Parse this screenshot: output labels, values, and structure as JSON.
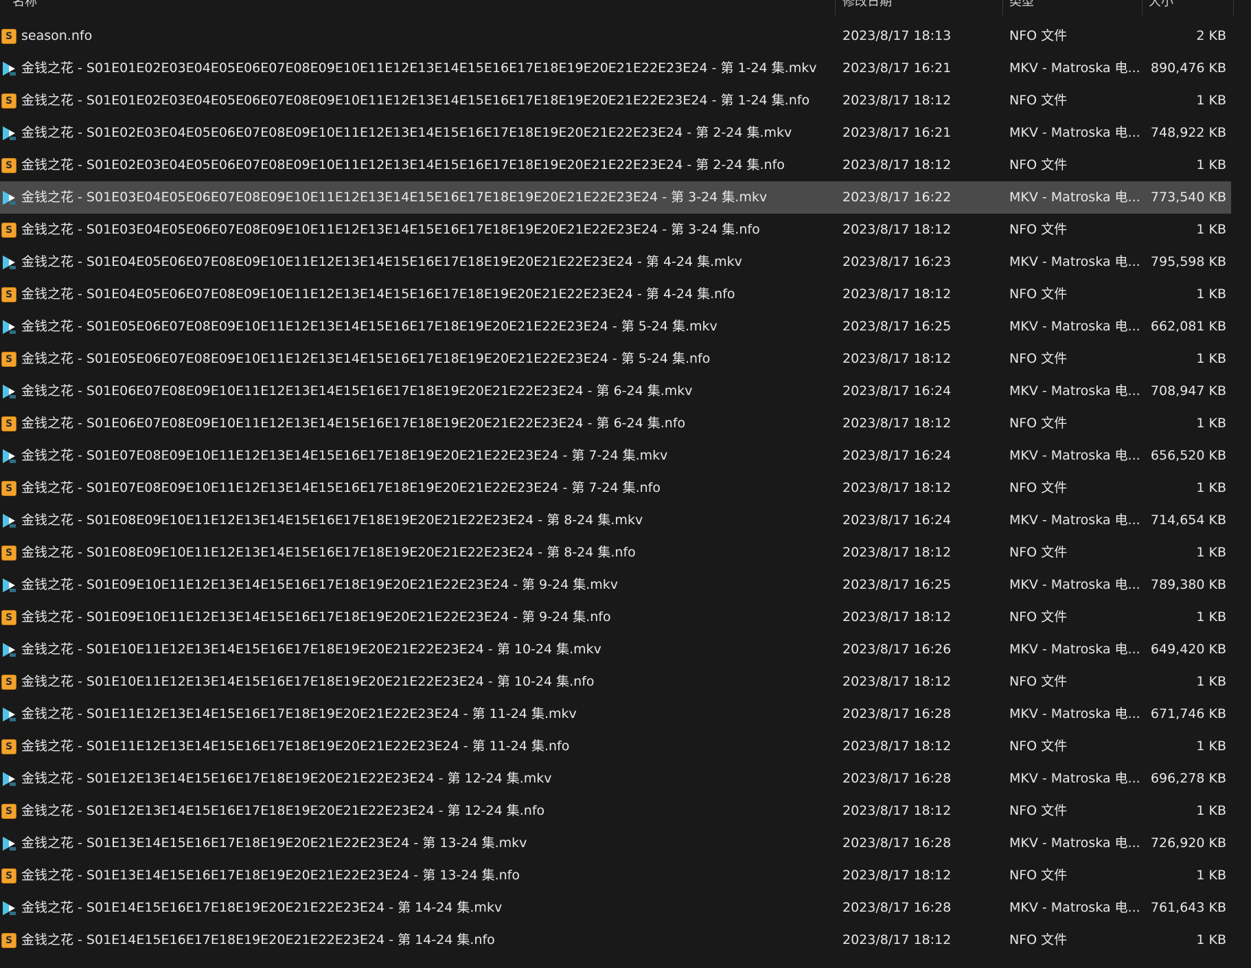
{
  "columns": {
    "name": "名称",
    "date": "修改日期",
    "type": "类型",
    "size": "大小"
  },
  "colors": {
    "background": "#191919",
    "selected_row": "#4a4a4a",
    "nfo_icon": "#f3a32b",
    "mkv_icon": "#4fc3e8"
  },
  "files": [
    {
      "name": "season.nfo",
      "date": "2023/8/17 18:13",
      "type": "NFO 文件",
      "size": "2 KB",
      "icon": "nfo-file-icon"
    },
    {
      "name": "金钱之花 - S01E01E02E03E04E05E06E07E08E09E10E11E12E13E14E15E16E17E18E19E20E21E22E23E24 - 第 1-24 集.mkv",
      "date": "2023/8/17 16:21",
      "type": "MKV - Matroska 电...",
      "size": "890,476 KB",
      "icon": "mkv-file-icon"
    },
    {
      "name": "金钱之花 - S01E01E02E03E04E05E06E07E08E09E10E11E12E13E14E15E16E17E18E19E20E21E22E23E24 - 第 1-24 集.nfo",
      "date": "2023/8/17 18:12",
      "type": "NFO 文件",
      "size": "1 KB",
      "icon": "nfo-file-icon"
    },
    {
      "name": "金钱之花 - S01E02E03E04E05E06E07E08E09E10E11E12E13E14E15E16E17E18E19E20E21E22E23E24 - 第 2-24 集.mkv",
      "date": "2023/8/17 16:21",
      "type": "MKV - Matroska 电...",
      "size": "748,922 KB",
      "icon": "mkv-file-icon"
    },
    {
      "name": "金钱之花 - S01E02E03E04E05E06E07E08E09E10E11E12E13E14E15E16E17E18E19E20E21E22E23E24 - 第 2-24 集.nfo",
      "date": "2023/8/17 18:12",
      "type": "NFO 文件",
      "size": "1 KB",
      "icon": "nfo-file-icon"
    },
    {
      "name": "金钱之花 - S01E03E04E05E06E07E08E09E10E11E12E13E14E15E16E17E18E19E20E21E22E23E24 - 第 3-24 集.mkv",
      "date": "2023/8/17 16:22",
      "type": "MKV - Matroska 电...",
      "size": "773,540 KB",
      "icon": "mkv-file-icon",
      "selected": true
    },
    {
      "name": "金钱之花 - S01E03E04E05E06E07E08E09E10E11E12E13E14E15E16E17E18E19E20E21E22E23E24 - 第 3-24 集.nfo",
      "date": "2023/8/17 18:12",
      "type": "NFO 文件",
      "size": "1 KB",
      "icon": "nfo-file-icon"
    },
    {
      "name": "金钱之花 - S01E04E05E06E07E08E09E10E11E12E13E14E15E16E17E18E19E20E21E22E23E24 - 第 4-24 集.mkv",
      "date": "2023/8/17 16:23",
      "type": "MKV - Matroska 电...",
      "size": "795,598 KB",
      "icon": "mkv-file-icon"
    },
    {
      "name": "金钱之花 - S01E04E05E06E07E08E09E10E11E12E13E14E15E16E17E18E19E20E21E22E23E24 - 第 4-24 集.nfo",
      "date": "2023/8/17 18:12",
      "type": "NFO 文件",
      "size": "1 KB",
      "icon": "nfo-file-icon"
    },
    {
      "name": "金钱之花 - S01E05E06E07E08E09E10E11E12E13E14E15E16E17E18E19E20E21E22E23E24 - 第 5-24 集.mkv",
      "date": "2023/8/17 16:25",
      "type": "MKV - Matroska 电...",
      "size": "662,081 KB",
      "icon": "mkv-file-icon"
    },
    {
      "name": "金钱之花 - S01E05E06E07E08E09E10E11E12E13E14E15E16E17E18E19E20E21E22E23E24 - 第 5-24 集.nfo",
      "date": "2023/8/17 18:12",
      "type": "NFO 文件",
      "size": "1 KB",
      "icon": "nfo-file-icon"
    },
    {
      "name": "金钱之花 - S01E06E07E08E09E10E11E12E13E14E15E16E17E18E19E20E21E22E23E24 - 第 6-24 集.mkv",
      "date": "2023/8/17 16:24",
      "type": "MKV - Matroska 电...",
      "size": "708,947 KB",
      "icon": "mkv-file-icon"
    },
    {
      "name": "金钱之花 - S01E06E07E08E09E10E11E12E13E14E15E16E17E18E19E20E21E22E23E24 - 第 6-24 集.nfo",
      "date": "2023/8/17 18:12",
      "type": "NFO 文件",
      "size": "1 KB",
      "icon": "nfo-file-icon"
    },
    {
      "name": "金钱之花 - S01E07E08E09E10E11E12E13E14E15E16E17E18E19E20E21E22E23E24 - 第 7-24 集.mkv",
      "date": "2023/8/17 16:24",
      "type": "MKV - Matroska 电...",
      "size": "656,520 KB",
      "icon": "mkv-file-icon"
    },
    {
      "name": "金钱之花 - S01E07E08E09E10E11E12E13E14E15E16E17E18E19E20E21E22E23E24 - 第 7-24 集.nfo",
      "date": "2023/8/17 18:12",
      "type": "NFO 文件",
      "size": "1 KB",
      "icon": "nfo-file-icon"
    },
    {
      "name": "金钱之花 - S01E08E09E10E11E12E13E14E15E16E17E18E19E20E21E22E23E24 - 第 8-24 集.mkv",
      "date": "2023/8/17 16:24",
      "type": "MKV - Matroska 电...",
      "size": "714,654 KB",
      "icon": "mkv-file-icon"
    },
    {
      "name": "金钱之花 - S01E08E09E10E11E12E13E14E15E16E17E18E19E20E21E22E23E24 - 第 8-24 集.nfo",
      "date": "2023/8/17 18:12",
      "type": "NFO 文件",
      "size": "1 KB",
      "icon": "nfo-file-icon"
    },
    {
      "name": "金钱之花 - S01E09E10E11E12E13E14E15E16E17E18E19E20E21E22E23E24 - 第 9-24 集.mkv",
      "date": "2023/8/17 16:25",
      "type": "MKV - Matroska 电...",
      "size": "789,380 KB",
      "icon": "mkv-file-icon"
    },
    {
      "name": "金钱之花 - S01E09E10E11E12E13E14E15E16E17E18E19E20E21E22E23E24 - 第 9-24 集.nfo",
      "date": "2023/8/17 18:12",
      "type": "NFO 文件",
      "size": "1 KB",
      "icon": "nfo-file-icon"
    },
    {
      "name": "金钱之花 - S01E10E11E12E13E14E15E16E17E18E19E20E21E22E23E24 - 第 10-24 集.mkv",
      "date": "2023/8/17 16:26",
      "type": "MKV - Matroska 电...",
      "size": "649,420 KB",
      "icon": "mkv-file-icon"
    },
    {
      "name": "金钱之花 - S01E10E11E12E13E14E15E16E17E18E19E20E21E22E23E24 - 第 10-24 集.nfo",
      "date": "2023/8/17 18:12",
      "type": "NFO 文件",
      "size": "1 KB",
      "icon": "nfo-file-icon"
    },
    {
      "name": "金钱之花 - S01E11E12E13E14E15E16E17E18E19E20E21E22E23E24 - 第 11-24 集.mkv",
      "date": "2023/8/17 16:28",
      "type": "MKV - Matroska 电...",
      "size": "671,746 KB",
      "icon": "mkv-file-icon"
    },
    {
      "name": "金钱之花 - S01E11E12E13E14E15E16E17E18E19E20E21E22E23E24 - 第 11-24 集.nfo",
      "date": "2023/8/17 18:12",
      "type": "NFO 文件",
      "size": "1 KB",
      "icon": "nfo-file-icon"
    },
    {
      "name": "金钱之花 - S01E12E13E14E15E16E17E18E19E20E21E22E23E24 - 第 12-24 集.mkv",
      "date": "2023/8/17 16:28",
      "type": "MKV - Matroska 电...",
      "size": "696,278 KB",
      "icon": "mkv-file-icon"
    },
    {
      "name": "金钱之花 - S01E12E13E14E15E16E17E18E19E20E21E22E23E24 - 第 12-24 集.nfo",
      "date": "2023/8/17 18:12",
      "type": "NFO 文件",
      "size": "1 KB",
      "icon": "nfo-file-icon"
    },
    {
      "name": "金钱之花 - S01E13E14E15E16E17E18E19E20E21E22E23E24 - 第 13-24 集.mkv",
      "date": "2023/8/17 16:28",
      "type": "MKV - Matroska 电...",
      "size": "726,920 KB",
      "icon": "mkv-file-icon"
    },
    {
      "name": "金钱之花 - S01E13E14E15E16E17E18E19E20E21E22E23E24 - 第 13-24 集.nfo",
      "date": "2023/8/17 18:12",
      "type": "NFO 文件",
      "size": "1 KB",
      "icon": "nfo-file-icon"
    },
    {
      "name": "金钱之花 - S01E14E15E16E17E18E19E20E21E22E23E24 - 第 14-24 集.mkv",
      "date": "2023/8/17 16:28",
      "type": "MKV - Matroska 电...",
      "size": "761,643 KB",
      "icon": "mkv-file-icon"
    },
    {
      "name": "金钱之花 - S01E14E15E16E17E18E19E20E21E22E23E24 - 第 14-24 集.nfo",
      "date": "2023/8/17 18:12",
      "type": "NFO 文件",
      "size": "1 KB",
      "icon": "nfo-file-icon"
    }
  ]
}
